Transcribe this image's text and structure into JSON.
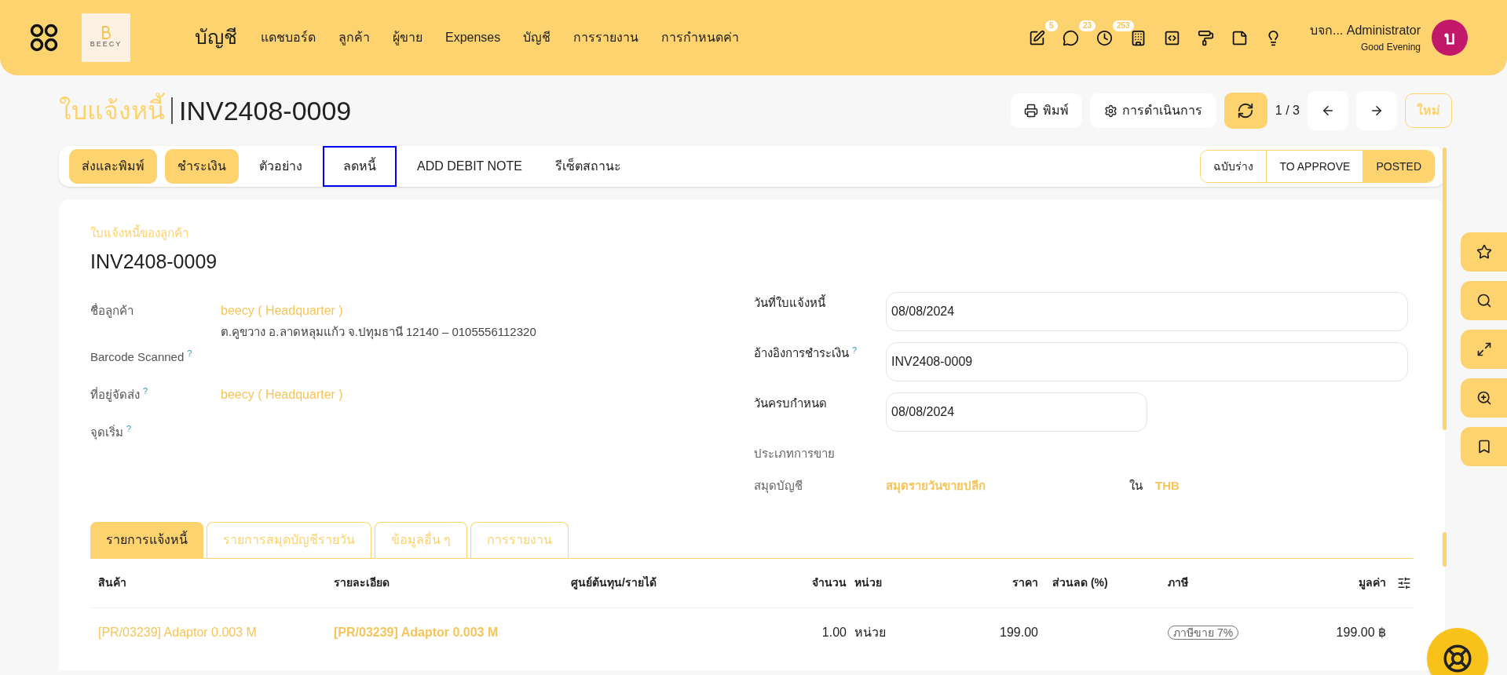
{
  "topbar": {
    "app_title": "บัญชี",
    "logo_text": "BEECY",
    "nav": [
      "แดชบอร์ด",
      "ลูกค้า",
      "ผู้ขาย",
      "Expenses",
      "บัญชี",
      "การรายงาน",
      "การกำหนดค่า"
    ],
    "icons": [
      {
        "kind": "edit",
        "badge": "5"
      },
      {
        "kind": "chat",
        "badge": "23"
      },
      {
        "kind": "activity",
        "badge": "253"
      },
      {
        "kind": "building"
      },
      {
        "kind": "code"
      },
      {
        "kind": "roller"
      },
      {
        "kind": "note"
      },
      {
        "kind": "bulb"
      }
    ],
    "user": {
      "name": "บจก... Administrator",
      "greeting": "Good Evening",
      "avatar": "บ"
    }
  },
  "breadcrumb": {
    "parent": "ใบแจ้งหนี้",
    "record": "INV2408-0009"
  },
  "toolbar": {
    "print": "พิมพ์",
    "actions": "การดำเนินการ",
    "pager": "1 / 3",
    "new": "ใหม่"
  },
  "action_buttons": [
    {
      "label": "ส่งและพิมพ์",
      "kind": "primary",
      "highlighted": false
    },
    {
      "label": "ชำระเงิน",
      "kind": "primary",
      "highlighted": false
    },
    {
      "label": "ตัวอย่าง",
      "kind": "plain",
      "highlighted": false
    },
    {
      "label": "ลดหนี้",
      "kind": "plain",
      "highlighted": true
    },
    {
      "label": "ADD DEBIT NOTE",
      "kind": "plain",
      "highlighted": false
    },
    {
      "label": "รีเซ็ตสถานะ",
      "kind": "plain",
      "highlighted": false
    }
  ],
  "statuses": [
    {
      "label": "ฉบับร่าง",
      "selected": false
    },
    {
      "label": "TO APPROVE",
      "selected": false
    },
    {
      "label": "POSTED",
      "selected": true
    }
  ],
  "form": {
    "subtitle": "ใบแจ้งหนี้ของลูกค้า",
    "number": "INV2408-0009",
    "left_fields": [
      {
        "label": "ชื่อลูกค้า",
        "value": "beecy ( Headquarter )",
        "value_line_2": "ต.คูขวาง อ.ลาดหลุมแก้ว จ.ปทุมธานี 12140 – 0105556112320"
      },
      {
        "label": "Barcode Scanned",
        "help_mark": "?"
      },
      {
        "label": "ที่อยู่จัดส่ง",
        "help_mark": "?",
        "value": "beecy ( Headquarter )"
      },
      {
        "label": "จุดเริ่ม",
        "help_mark": "?"
      }
    ],
    "right_fields": [
      {
        "label": "วันที่ใบแจ้งหนี้",
        "kind": "input",
        "value": "08/08/2024"
      },
      {
        "label": "อ้างอิงการชำระเงิน",
        "help_mark": "?",
        "kind": "input",
        "value": "INV2408-0009"
      },
      {
        "label": "วันครบกำหนด",
        "kind": "short_input",
        "value": "08/08/2024"
      },
      {
        "label": "ประเภทการขาย",
        "kind": "empty"
      }
    ],
    "journal": {
      "label": "สมุดบัญชี",
      "value": "สมุดรายวันขายปลีก",
      "currency_label": "ใน",
      "currency": "THB"
    }
  },
  "tabs": [
    {
      "label": "รายการแจ้งหนี้",
      "selected": true
    },
    {
      "label": "รายการสมุดบัญชีรายวัน",
      "selected": false
    },
    {
      "label": "ข้อมูลอื่น ๆ",
      "selected": false
    },
    {
      "label": "การรายงาน",
      "selected": false
    }
  ],
  "table": {
    "columns": [
      "สินค้า",
      "รายละเอียด",
      "ศูนย์ต้นทุน/รายได้",
      "จำนวน",
      "หน่วย",
      "ราคา",
      "ส่วนลด (%)",
      "ภาษี",
      "มูลค่า"
    ],
    "rows": [
      {
        "product": "[PR/03239] Adaptor 0.003 M",
        "description": "[PR/03239] Adaptor 0.003 M",
        "quantity": "1.00",
        "unit": "หน่วย",
        "price": "199.00",
        "tax": "ภาษีขาย 7%",
        "amount": "199.00 ฿"
      }
    ]
  }
}
